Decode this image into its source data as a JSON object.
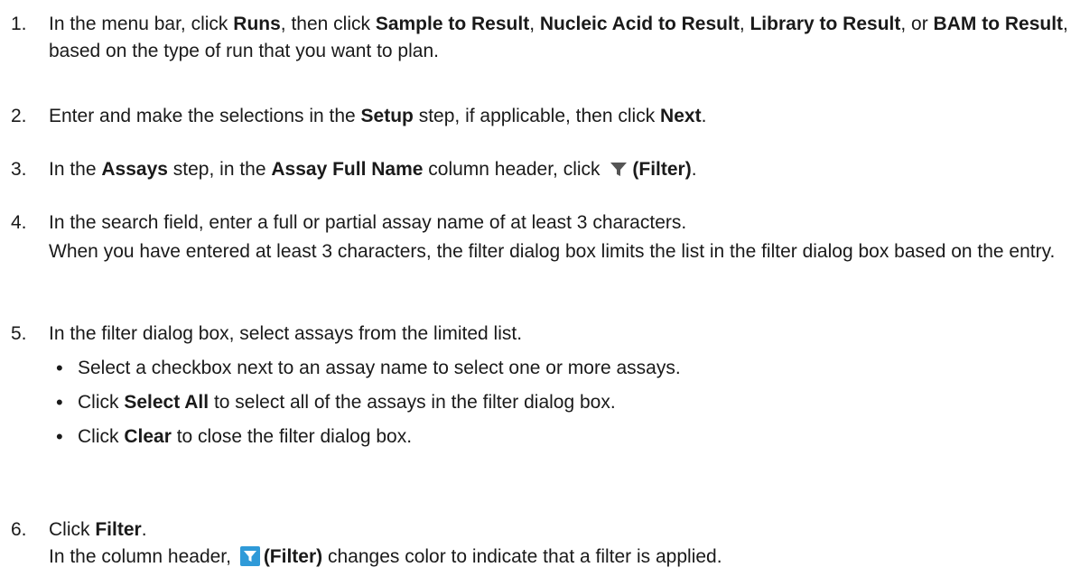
{
  "steps": [
    {
      "num": "1.",
      "parts": [
        {
          "t": "In the menu bar, click "
        },
        {
          "t": "Runs",
          "b": true
        },
        {
          "t": ", then click "
        },
        {
          "t": "Sample to Result",
          "b": true
        },
        {
          "t": ", "
        },
        {
          "t": "Nucleic Acid to Result",
          "b": true
        },
        {
          "t": ", "
        },
        {
          "t": "Library to Result",
          "b": true
        },
        {
          "t": ", or "
        },
        {
          "t": "BAM to Result",
          "b": true
        },
        {
          "t": ", based on the type of run that you want to plan."
        }
      ]
    },
    {
      "num": "2.",
      "parts": [
        {
          "t": "Enter and make the selections in the "
        },
        {
          "t": "Setup",
          "b": true
        },
        {
          "t": " step, if applicable, then click "
        },
        {
          "t": "Next",
          "b": true
        },
        {
          "t": "."
        }
      ]
    },
    {
      "num": "3.",
      "parts": [
        {
          "t": "In the "
        },
        {
          "t": "Assays",
          "b": true
        },
        {
          "t": " step, in the "
        },
        {
          "t": "Assay Full Name",
          "b": true
        },
        {
          "t": " column header, click "
        },
        {
          "icon": "filter-icon"
        },
        {
          "t": "(Filter)",
          "b": true
        },
        {
          "t": "."
        }
      ]
    },
    {
      "num": "4.",
      "parts": [
        {
          "t": "In the search field, enter a full or partial assay name of at least 3 characters."
        }
      ],
      "extra": "When you have entered at least 3 characters, the filter dialog box limits the list in the filter dialog box based on the entry."
    },
    {
      "num": "5.",
      "parts": [
        {
          "t": "In the filter dialog box, select assays from the limited list."
        }
      ],
      "bullets": [
        [
          {
            "t": "Select a checkbox next to an assay name to select one or more assays."
          }
        ],
        [
          {
            "t": "Click "
          },
          {
            "t": "Select All",
            "b": true
          },
          {
            "t": " to select all of the assays in the filter dialog box."
          }
        ],
        [
          {
            "t": "Click "
          },
          {
            "t": "Clear",
            "b": true
          },
          {
            "t": " to close the filter dialog box."
          }
        ]
      ]
    },
    {
      "num": "6.",
      "parts": [
        {
          "t": "Click "
        },
        {
          "t": "Filter",
          "b": true
        },
        {
          "t": "."
        }
      ],
      "extra_parts": [
        {
          "t": "In the column header, "
        },
        {
          "icon": "filter-active-icon"
        },
        {
          "t": "(Filter)",
          "b": true
        },
        {
          "t": " changes color to indicate that a filter is applied."
        }
      ]
    }
  ],
  "icon_colors": {
    "filter-icon": "#555555",
    "filter-active-icon": "#2f9ad8"
  }
}
